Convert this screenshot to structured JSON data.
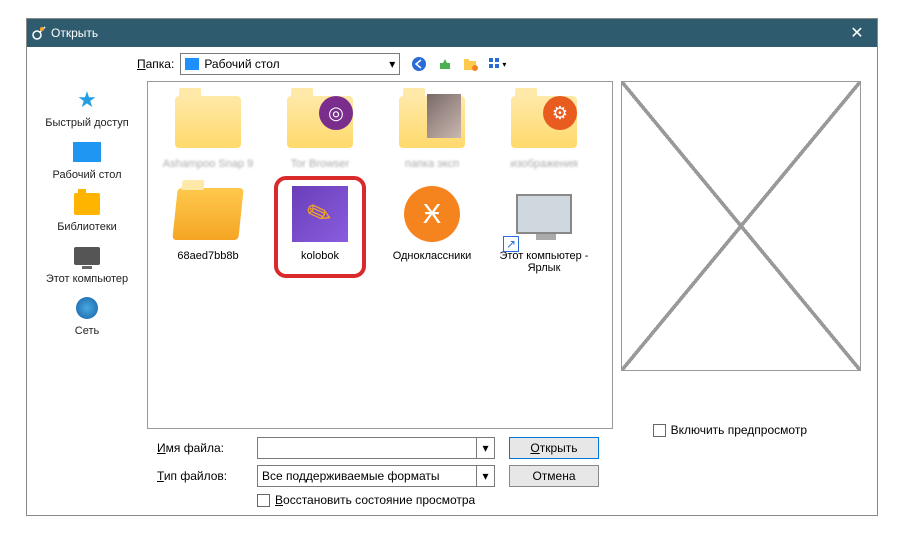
{
  "titlebar": {
    "title": "Открыть",
    "close": "✕"
  },
  "toolbar": {
    "folder_label": "Папка:",
    "selected_folder": "Рабочий стол"
  },
  "sidebar": {
    "quick_access": "Быстрый доступ",
    "desktop": "Рабочий стол",
    "libraries": "Библиотеки",
    "this_pc": "Этот компьютер",
    "network": "Сеть"
  },
  "files": {
    "row1": [
      {
        "label": "Ashampoo Snap 9"
      },
      {
        "label": "Tor Browser"
      },
      {
        "label": "папка эксп"
      },
      {
        "label": "изображения"
      }
    ],
    "row2": {
      "item1": "68aed7bb8b",
      "item2": "kolobok",
      "item3": "Одноклассники",
      "item4": "Этот компьютер - Ярлык"
    }
  },
  "fields": {
    "filename_label": "Имя файла:",
    "filename_value": "",
    "filetype_label": "Тип файлов:",
    "filetype_value": "Все поддерживаемые форматы",
    "restore_label": "Восстановить состояние просмотра"
  },
  "buttons": {
    "open": "Открыть",
    "cancel": "Отмена"
  },
  "preview_checkbox": "Включить предпросмотр"
}
